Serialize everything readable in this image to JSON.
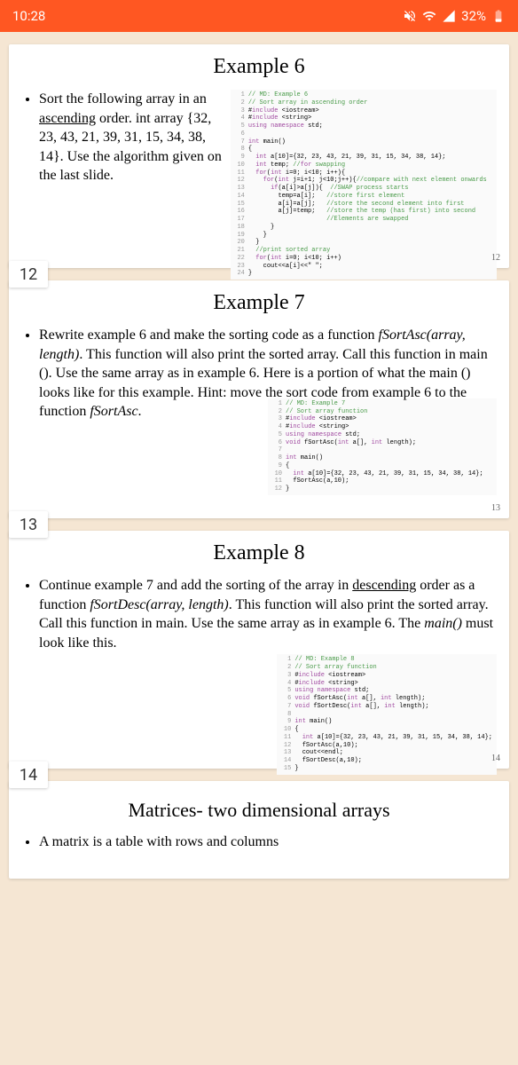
{
  "status": {
    "time": "10:28",
    "battery": "32%"
  },
  "pages": {
    "p12": "12",
    "p13": "13",
    "p14": "14"
  },
  "cards": {
    "example6": {
      "title": "Example 6",
      "text_1": "Sort the following array in an ",
      "text_2": "ascending",
      "text_3": " order. int array {32, 23, 43, 21, 39, 31, 15, 34, 38, 14}. Use the algorithm given on the last slide.",
      "code_lines": [
        "// MD: Example 6",
        "// Sort array in ascending order",
        "#include <iostream>",
        "#include <string>",
        "using namespace std;",
        "",
        "int main()",
        "{",
        "  int a[10]={32, 23, 43, 21, 39, 31, 15, 34, 38, 14};",
        "  int temp; //for swapping",
        "  for(int i=0; i<10; i++){",
        "    for(int j=i+1; j<10;j++){//compare with next element onwards",
        "      if(a[i]>a[j]){  //SWAP process starts",
        "        temp=a[i];   //store first element",
        "        a[i]=a[j];   //store the second element into first",
        "        a[j]=temp;   //store the temp (has first) into second",
        "                     //Elements are swapped",
        "      }",
        "    }",
        "  }",
        "  //print sorted array",
        "  for(int i=0; i<10; i++)",
        "    cout<<a[i]<<\" \";",
        "}"
      ],
      "pagenum": "12"
    },
    "example7": {
      "title": "Example 7",
      "text_1": "Rewrite example 6 and make the sorting code as a function ",
      "text_2": "fSortAsc(array, length)",
      "text_3": ". This function will also print the sorted array. Call this function in main (). Use the same array as in example 6. Here is a portion of what the main () looks like for this example. Hint: move the sort code from example 6 to the function ",
      "code_lines": [
        "// MD: Example 7",
        "// Sort array function",
        "#include <iostream>",
        "#include <string>",
        "using namespace std;",
        "void fSortAsc(int a[], int length);",
        "",
        "int main()",
        "{",
        "  int a[10]={32, 23, 43, 21, 39, 31, 15, 34, 38, 14};",
        "  fSortAsc(a,10);",
        "}"
      ],
      "pagenum": "13"
    },
    "example8": {
      "title": "Example 8",
      "text_1": "Continue example 7 and add the sorting of the array in ",
      "text_2": "descending",
      "text_3": " order as a function ",
      "text_4": "fSortDesc(array, length)",
      "text_5": ". This function will also print the sorted array. Call this function in main. Use the same array as in example 6. The ",
      "text_6": "main()",
      "text_7": " must look like this.",
      "code_lines": [
        "// MD: Example 8",
        "// Sort array function",
        "#include <iostream>",
        "#include <string>",
        "using namespace std;",
        "void fSortAsc(int a[], int length);",
        "void fSortDesc(int a[], int length);",
        "",
        "int main()",
        "{",
        "  int a[10]={32, 23, 43, 21, 39, 31, 15, 34, 38, 14};",
        "  fSortAsc(a,10);",
        "  cout<<endl;",
        "  fSortDesc(a,10);",
        "}"
      ],
      "pagenum": "14"
    },
    "matrices": {
      "title": "Matrices- two dimensional arrays",
      "text": "A matrix is a table with rows and columns"
    }
  }
}
